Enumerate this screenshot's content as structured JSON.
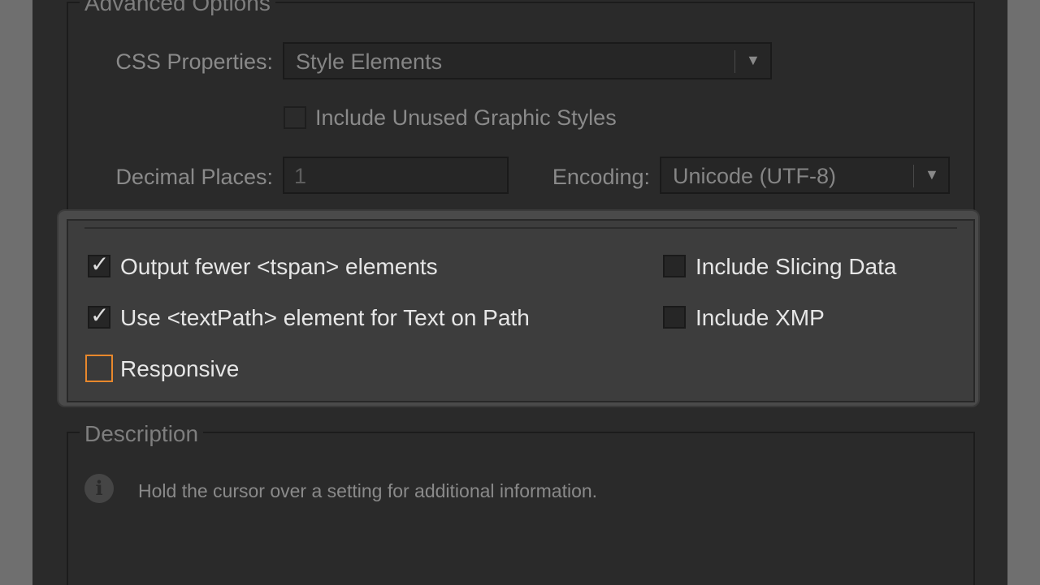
{
  "advanced": {
    "legend": "Advanced Options",
    "css_label": "CSS Properties:",
    "css_value": "Style Elements",
    "unused_styles_label": "Include Unused Graphic Styles",
    "decimal_label": "Decimal Places:",
    "decimal_value": "1",
    "encoding_label": "Encoding:",
    "encoding_value": "Unicode (UTF-8)"
  },
  "options": {
    "fewer_tspan": "Output fewer <tspan> elements",
    "textpath": "Use <textPath> element for Text on Path",
    "responsive": "Responsive",
    "slicing": "Include Slicing Data",
    "xmp": "Include XMP"
  },
  "checkbox_states": {
    "fewer_tspan": true,
    "textpath": true,
    "responsive": false,
    "slicing": false,
    "xmp": false,
    "unused_styles": false
  },
  "description": {
    "legend": "Description",
    "icon": "info-icon",
    "text": "Hold the cursor over a setting for additional information."
  },
  "colors": {
    "focus_ring": "#e8882c",
    "dialog_bg": "#2a2a2a",
    "panel_bg": "#3d3d3d"
  }
}
